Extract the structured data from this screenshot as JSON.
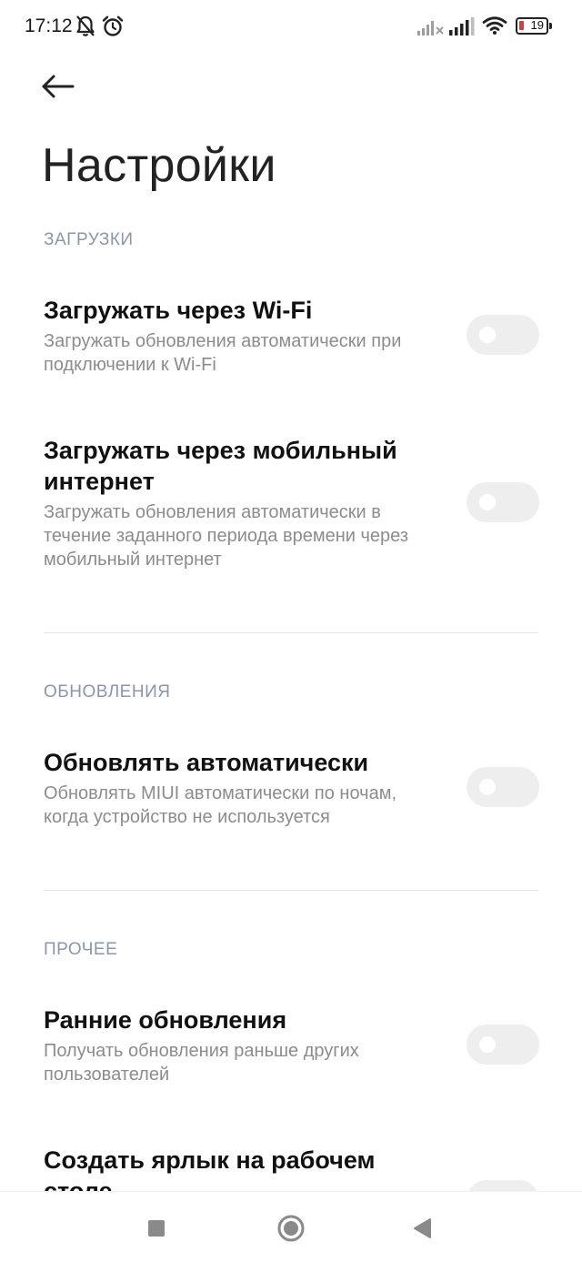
{
  "status_bar": {
    "time": "17:12",
    "icons": [
      "notifications-off-icon",
      "alarm-icon",
      "signal-no-service-icon",
      "signal-icon",
      "wifi-icon",
      "battery-icon"
    ],
    "battery_level": "19",
    "battery_color": "#e53935"
  },
  "header": {
    "back_icon": "arrow-left-icon",
    "title": "Настройки"
  },
  "sections": [
    {
      "label": "ЗАГРУЗКИ",
      "items": [
        {
          "title": "Загружать через Wi-Fi",
          "description": "Загружать обновления автоматически при подключении к Wi-Fi",
          "enabled": false
        },
        {
          "title": "Загружать через мобильный интернет",
          "description": "Загружать обновления автоматически в течение заданного периода времени через мобильный интернет",
          "enabled": false
        }
      ]
    },
    {
      "label": "ОБНОВЛЕНИЯ",
      "items": [
        {
          "title": "Обновлять автоматически",
          "description": "Обновлять MIUI автоматически по ночам, когда устройство не используется",
          "enabled": false
        }
      ]
    },
    {
      "label": "ПРОЧЕЕ",
      "items": [
        {
          "title": "Ранние обновления",
          "description": "Получать обновления раньше других пользователей",
          "enabled": false
        },
        {
          "title": "Создать ярлык на рабочем столе",
          "description": "",
          "enabled": false
        }
      ]
    }
  ],
  "nav_bar": {
    "icons": [
      "recents-square-icon",
      "home-circle-icon",
      "back-triangle-icon"
    ]
  },
  "colors": {
    "section_label": "#8a96ad",
    "toggle_off": "#eeeeee",
    "description": "#8c8c8c"
  }
}
